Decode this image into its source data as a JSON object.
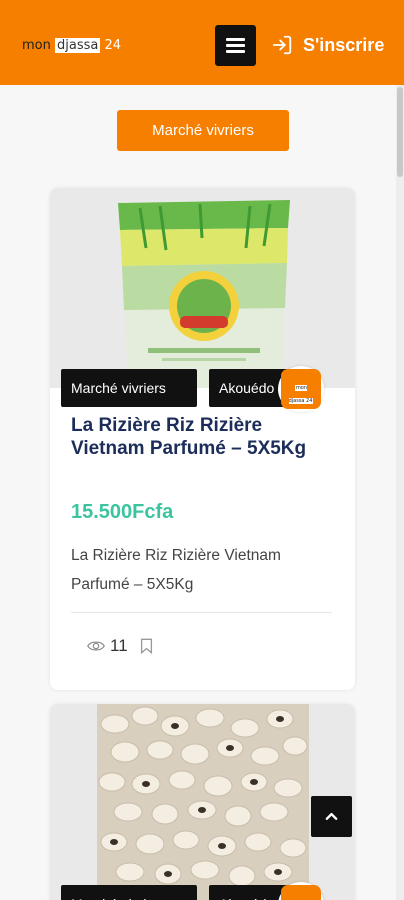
{
  "header": {
    "logo_mon": "mon",
    "logo_djassa": "djassa",
    "logo_num": "24",
    "menu_icon": "hamburger-menu-icon",
    "signup_icon": "login-arrow-icon",
    "signup_label": "S'inscrire",
    "accent_color": "#f77f00"
  },
  "category_button": "Marché vivriers",
  "listings": [
    {
      "category": "Marché vivriers",
      "location": "Akouédo",
      "title": "La Rizière Riz Rizière Vietnam Parfumé – 5X5Kg",
      "price": "15.500Fcfa",
      "description": "La Rizière Riz Rizière Vietnam Parfumé – 5X5Kg",
      "views": "11",
      "image": "rice-bag-photo",
      "avatar": "mon djassa 24",
      "view_icon": "eye-icon",
      "save_icon": "bookmark-icon"
    },
    {
      "category": "Marché vivriers",
      "location": "Akouédo",
      "image": "black-eyed-beans-photo",
      "avatar": "mon djassa 24"
    }
  ],
  "back_to_top_icon": "chevron-up-icon",
  "colors": {
    "price": "#3cc4a0",
    "title": "#1c2d5a"
  }
}
